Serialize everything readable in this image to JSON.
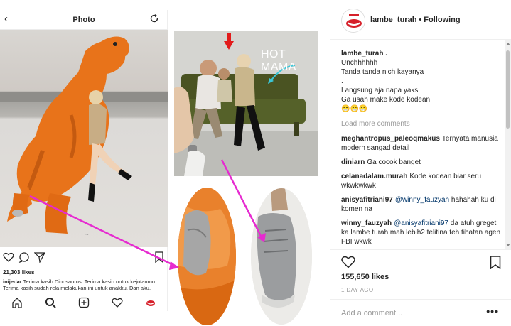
{
  "phone": {
    "title": "Photo",
    "likes": "21,303 likes",
    "caption_user": "inijedar",
    "caption_text": "Terima kasih Dinosaurus. Terima kasih untuk kejutanmu. Terima kasih sudah rela melakukan ini untuk anakku. Dan aku."
  },
  "couch_photo": {
    "overlay_text": "HOT MAMA"
  },
  "post": {
    "username": "lambe_turah",
    "separator": "•",
    "follow_status": "Following",
    "caption_user": "lambe_turah .",
    "caption_lines": [
      "Unchhhhhh",
      "Tanda tanda nich kayanya",
      ".",
      "Langsung aja napa yaks",
      "Ga usah make kode kodean",
      "😁😁😁"
    ],
    "load_more": "Load more comments",
    "comments": [
      {
        "user": "meghantropus_paleoqmakus",
        "mention": "",
        "text": "Ternyata manusia modern sangad detail"
      },
      {
        "user": "diniarn",
        "mention": "",
        "text": "Ga cocok banget"
      },
      {
        "user": "celanadalam.murah",
        "mention": "",
        "text": "Kode kodean biar seru wkwkwkwk"
      },
      {
        "user": "anisyafitriani97",
        "mention": "@winny_fauzyah",
        "text": "hahahah ku di komen na"
      },
      {
        "user": "winny_fauzyah",
        "mention": "@anisyafitriani97",
        "text": "da atuh greget ka lambe turah mah lebih2 telitina teh tibatan agen FBI wkwk"
      }
    ],
    "likes": "155,650 likes",
    "time": "1 DAY AGO",
    "add_comment_placeholder": "Add a comment...",
    "more_label": "•••"
  },
  "colors": {
    "arrow": "#e62bd0",
    "accent": "#003569",
    "muted": "#999999"
  }
}
